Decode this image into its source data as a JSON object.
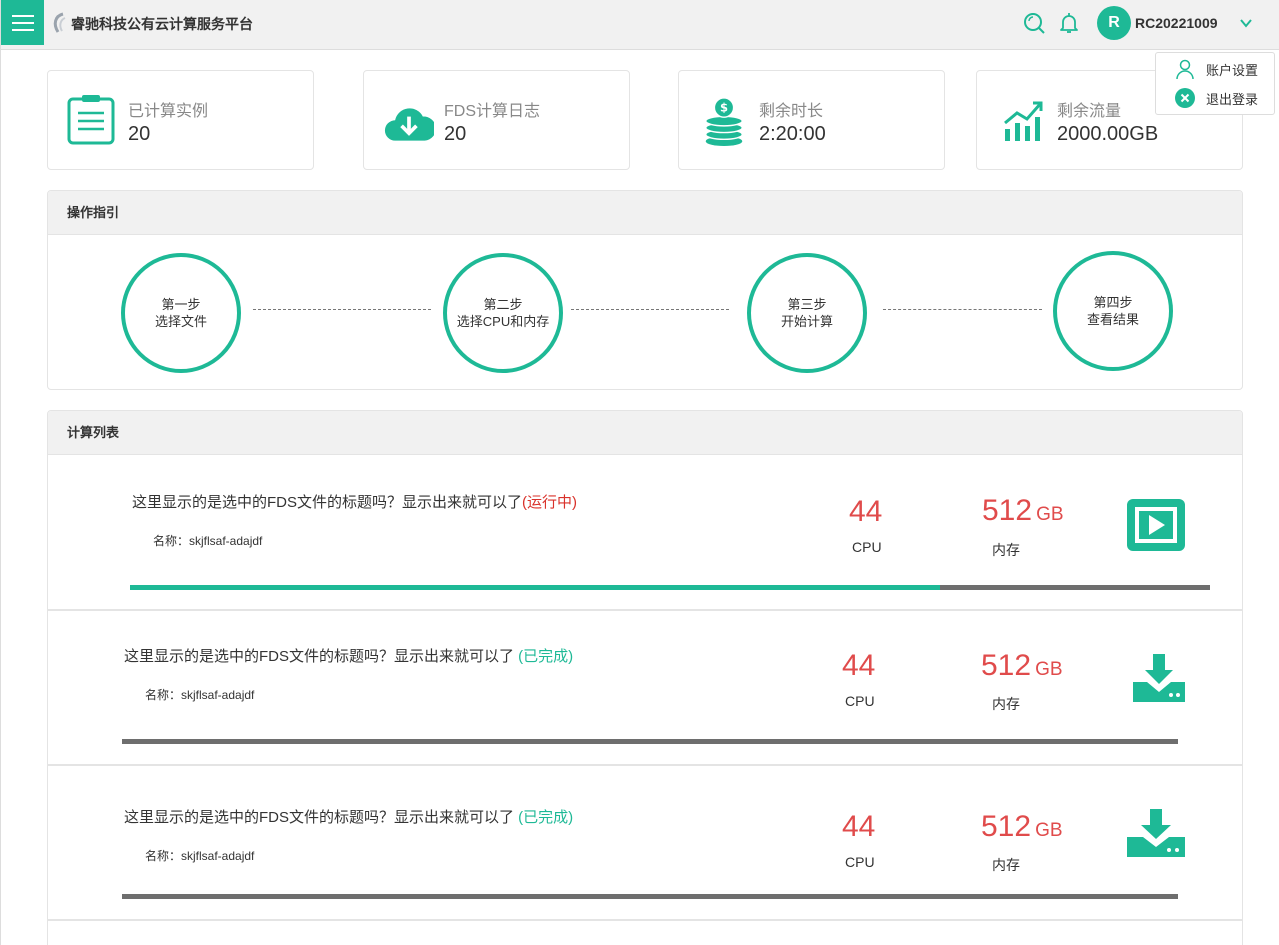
{
  "header": {
    "brand": "睿驰科技公有云计算服务平台",
    "avatar_letter": "R",
    "username": "RC20221009"
  },
  "user_menu": {
    "items": [
      {
        "label": "账户设置",
        "icon": "user-icon"
      },
      {
        "label": "退出登录",
        "icon": "logout-icon"
      }
    ]
  },
  "stats": [
    {
      "label": "已计算实例",
      "value": "20",
      "icon": "clipboard-icon"
    },
    {
      "label": "FDS计算日志",
      "value": "20",
      "icon": "cloud-download-icon"
    },
    {
      "label": "剩余时长",
      "value": "2:20:00",
      "icon": "coins-icon"
    },
    {
      "label": "剩余流量",
      "value": "2000.00GB",
      "icon": "chart-growth-icon"
    }
  ],
  "guide": {
    "title": "操作指引",
    "steps": [
      {
        "line1": "第一步",
        "line2": "选择文件"
      },
      {
        "line1": "第二步",
        "line2": "选择CPU和内存"
      },
      {
        "line1": "第三步",
        "line2": "开始计算"
      },
      {
        "line1": "第四步",
        "line2": "查看结果"
      }
    ]
  },
  "compute_list": {
    "title": "计算列表",
    "tasks": [
      {
        "title": "这里显示的是选中的FDS文件的标题吗？显示出来就可以了",
        "status": "(运行中)",
        "status_type": "running",
        "name": "名称：skjflsaf-adajdf",
        "cpu": "44",
        "cpu_label": "CPU",
        "memory": "512",
        "memory_unit": "GB",
        "memory_label": "内存",
        "progress": 0.75,
        "action_icon": "play-icon"
      },
      {
        "title": "这里显示的是选中的FDS文件的标题吗？显示出来就可以了",
        "status": " (已完成)",
        "status_type": "done",
        "name": "名称：skjflsaf-adajdf",
        "cpu": "44",
        "cpu_label": "CPU",
        "memory": "512",
        "memory_unit": "GB",
        "memory_label": "内存",
        "progress": 0,
        "action_icon": "download-icon"
      },
      {
        "title": "这里显示的是选中的FDS文件的标题吗？显示出来就可以了",
        "status": " (已完成)",
        "status_type": "done",
        "name": "名称：skjflsaf-adajdf",
        "cpu": "44",
        "cpu_label": "CPU",
        "memory": "512",
        "memory_unit": "GB",
        "memory_label": "内存",
        "progress": 0,
        "action_icon": "download-icon"
      }
    ]
  },
  "colors": {
    "accent": "#1eb996",
    "running": "#d9312a",
    "metric": "#e04b4b"
  }
}
